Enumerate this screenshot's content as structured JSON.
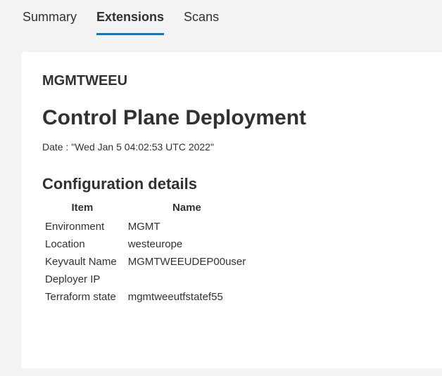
{
  "tabs": [
    {
      "label": "Summary"
    },
    {
      "label": "Extensions"
    },
    {
      "label": "Scans"
    }
  ],
  "activeTabIndex": 1,
  "card": {
    "id": "MGMTWEEU",
    "title": "Control Plane Deployment",
    "date_prefix": "Date : ",
    "date_value": "\"Wed Jan 5 04:02:53 UTC 2022\"",
    "section_title": "Configuration details",
    "columns": {
      "item": "Item",
      "name": "Name"
    },
    "rows": [
      {
        "item": "Environment",
        "name": "MGMT"
      },
      {
        "item": "Location",
        "name": "westeurope"
      },
      {
        "item": "Keyvault Name",
        "name": "MGMTWEEUDEP00user"
      },
      {
        "item": "Deployer IP",
        "name": ""
      },
      {
        "item": "Terraform state",
        "name": "mgmtweeutfstatef55"
      }
    ]
  }
}
